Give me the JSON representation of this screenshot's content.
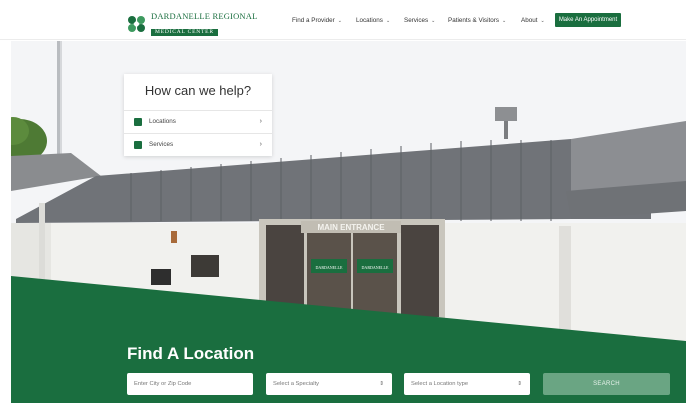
{
  "header": {
    "logo_line1": "DARDANELLE REGIONAL",
    "logo_line2": "MEDICAL CENTER",
    "nav": [
      {
        "label": "Find a Provider"
      },
      {
        "label": "Locations"
      },
      {
        "label": "Services"
      },
      {
        "label": "Patients & Visitors"
      },
      {
        "label": "About"
      }
    ],
    "cta_label": "Make An Appointment"
  },
  "hero": {
    "sign_text": "MAIN ENTRANCE",
    "door_text_left": "DARDANELLE",
    "door_text_right": "DARDANELLE"
  },
  "help_card": {
    "title": "How can we help?",
    "items": [
      {
        "label": "Locations",
        "icon": "map-icon"
      },
      {
        "label": "Services",
        "icon": "clipboard-icon"
      }
    ]
  },
  "find_location": {
    "title": "Find A Location",
    "zip_placeholder": "Enter City or Zip Code",
    "specialty_selected": "Select a Specialty",
    "location_type_selected": "Select a Location type",
    "search_label": "SEARCH"
  },
  "colors": {
    "brand_green": "#1a6e3f",
    "search_button": "#6aa583"
  }
}
